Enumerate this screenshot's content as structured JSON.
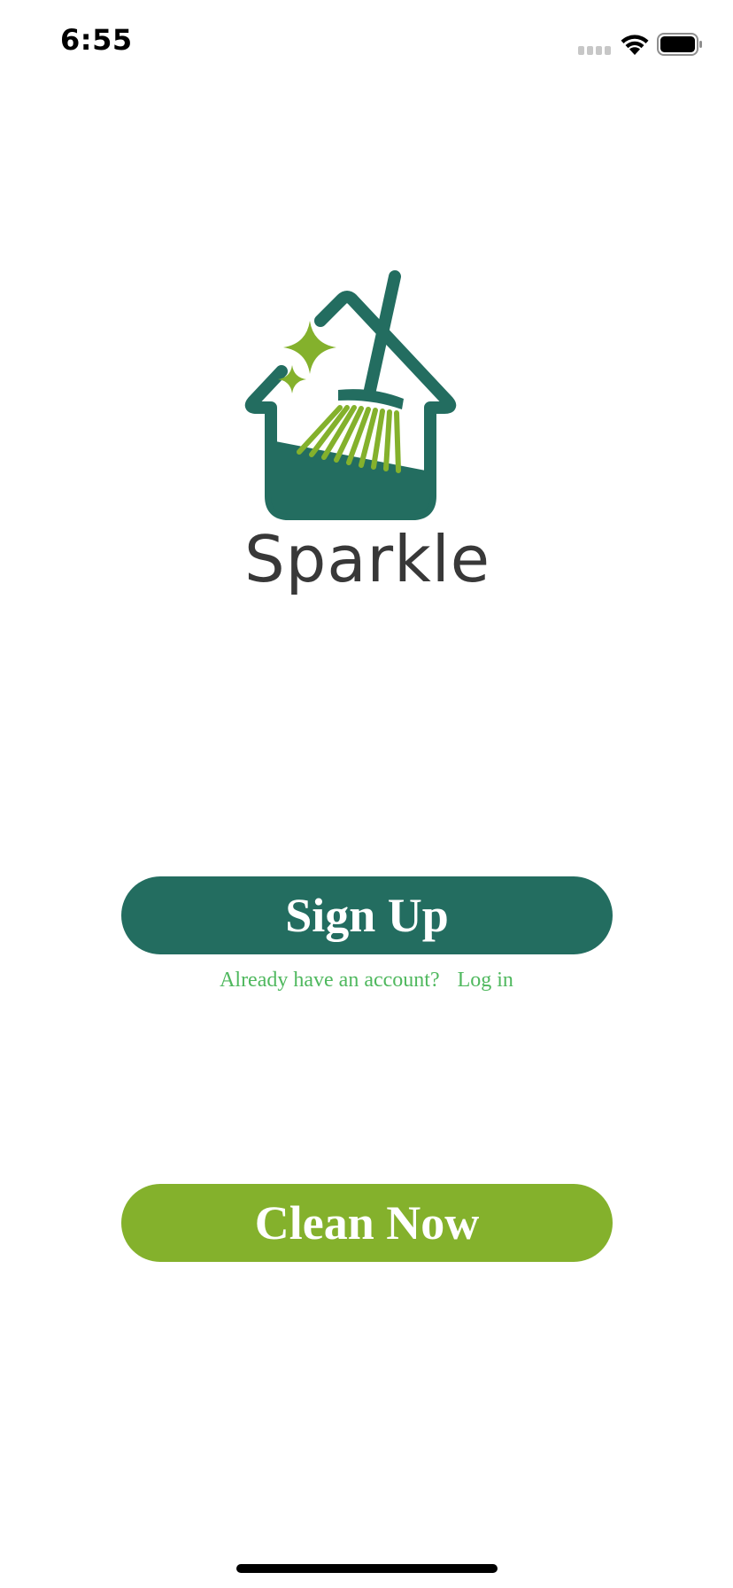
{
  "status_bar": {
    "time": "6:55"
  },
  "brand": {
    "name": "Sparkle",
    "logo_icon": "house-broom-sparkle-icon",
    "colors": {
      "primary": "#236d60",
      "accent": "#84b12c",
      "link": "#4fb85e",
      "text": "#383838"
    }
  },
  "actions": {
    "signup_label": "Sign Up",
    "login_prompt": "Already have an account?",
    "login_link": "Log in",
    "clean_label": "Clean Now"
  }
}
